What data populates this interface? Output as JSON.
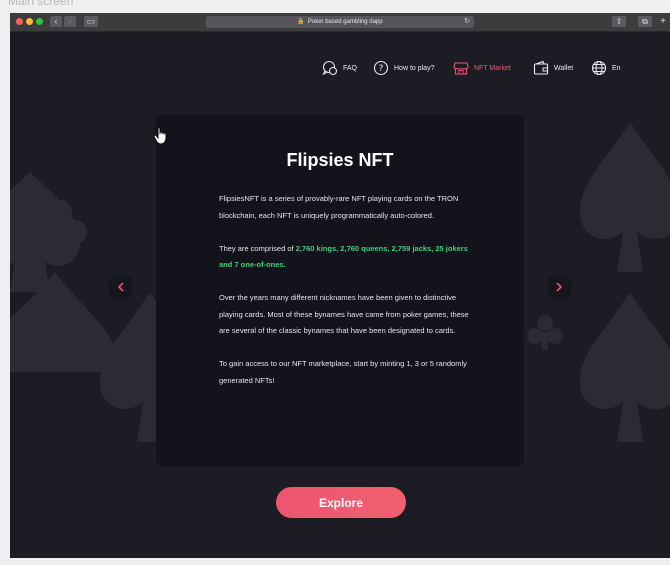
{
  "frame": {
    "label": "Main screen"
  },
  "browser": {
    "url": "Poker based gambling dapp"
  },
  "nav": {
    "items": [
      {
        "label": "FAQ",
        "icon": "faq-icon"
      },
      {
        "label": "How to play?",
        "icon": "question-icon"
      },
      {
        "label": "NFT Market",
        "icon": "store-icon",
        "active": true
      },
      {
        "label": "Wallet",
        "icon": "wallet-icon"
      },
      {
        "label": "En",
        "icon": "globe-icon"
      }
    ]
  },
  "card": {
    "title": "Flipsies NFT",
    "p1": "FlipsiesNFT is a series of provably-rare NFT playing cards on the TRON blockchain, each NFT is uniquely programmatically auto-colored.",
    "p2_prefix": "They are comprised of ",
    "p2_highlight": "2,760 kings, 2,760 queens, 2,759 jacks, 25 jokers and 7 one-of-ones.",
    "p3": "Over the years many different nicknames have been given to distinctive playing cards. Most of these bynames have came from poker games, these are several of the classic bynames that have been designated to cards.",
    "p4": "To gain access to our NFT marketplace, start by minting 1, 3 or 5 randomly generated NFTs!"
  },
  "explore_label": "Explore",
  "colors": {
    "accent": "#ee5470",
    "highlight": "#3ccf7a",
    "background": "#1c1d24",
    "card": "#13141b"
  }
}
